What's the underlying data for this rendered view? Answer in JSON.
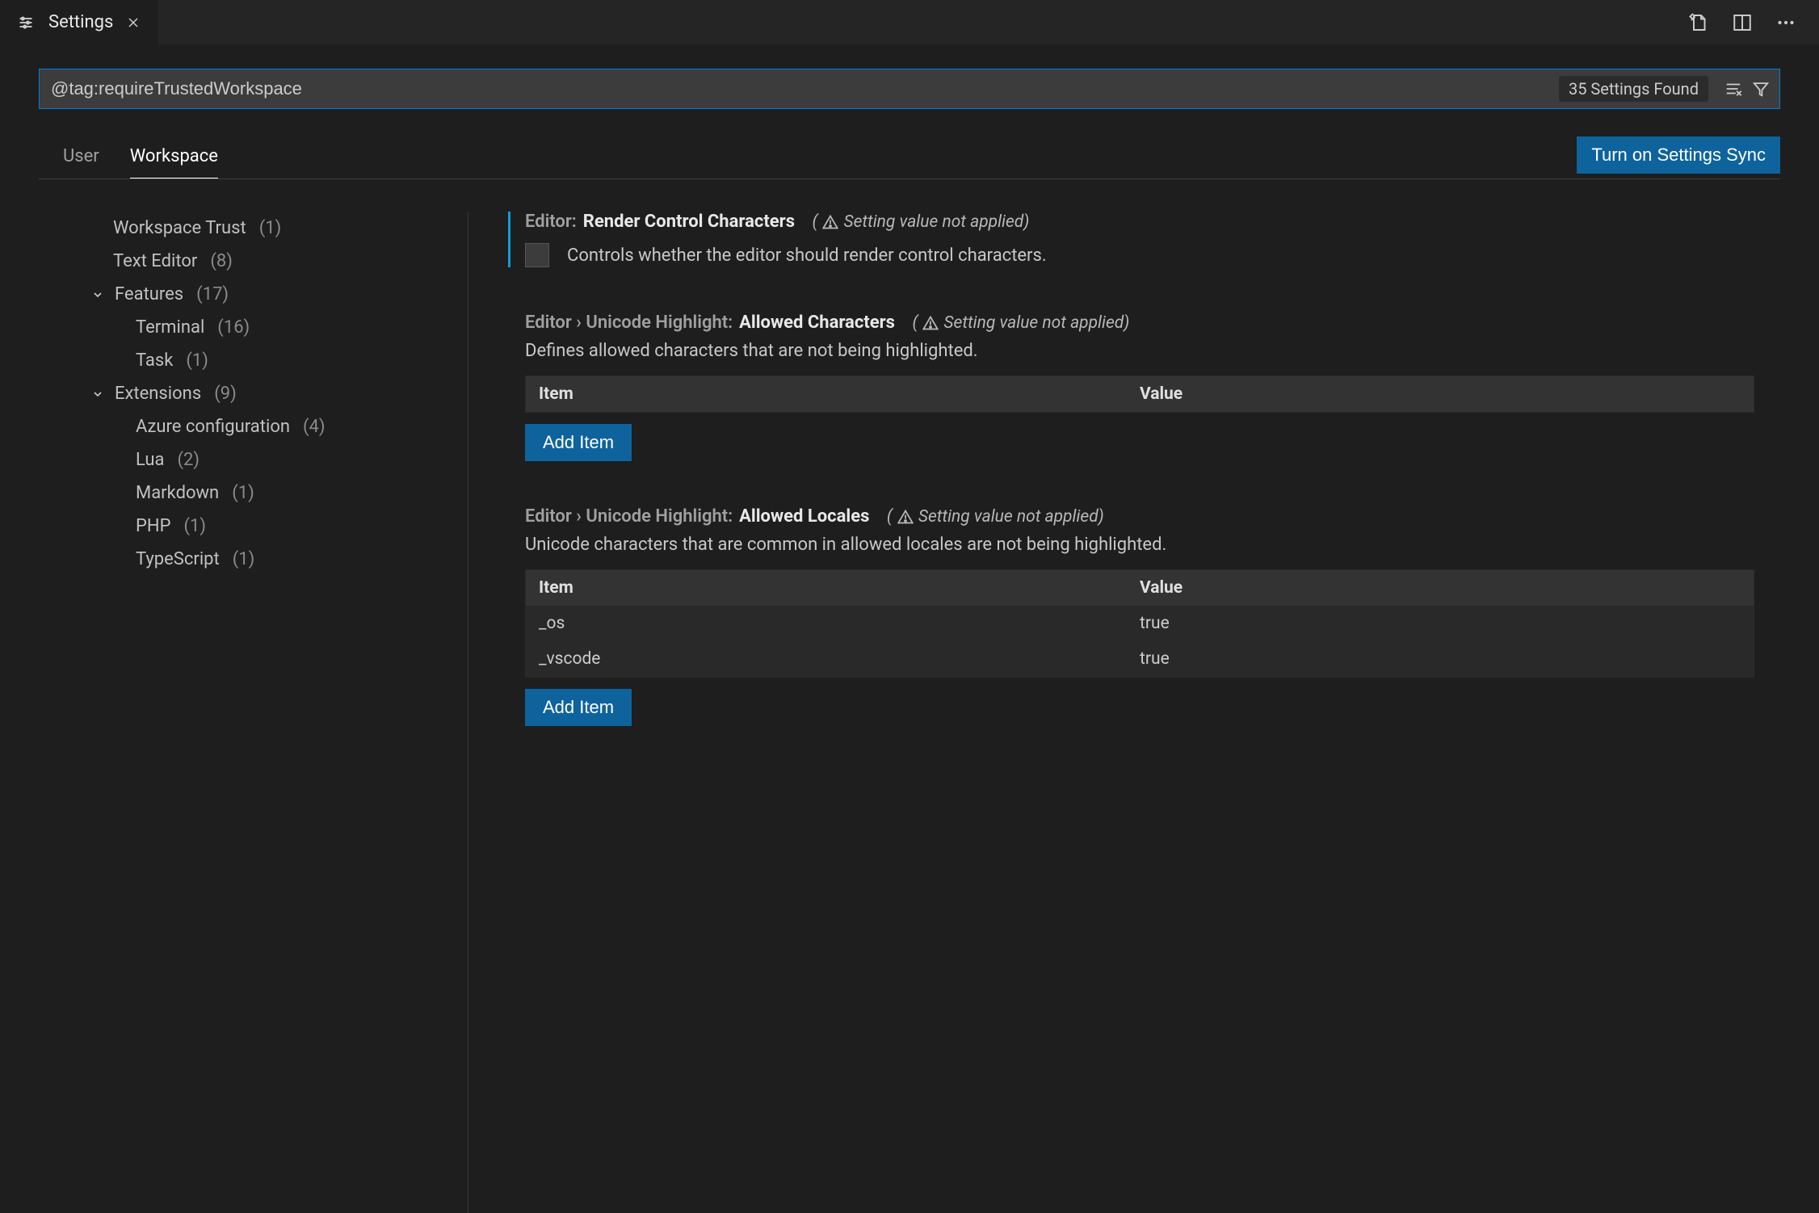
{
  "tab": {
    "title": "Settings"
  },
  "search": {
    "value": "@tag:requireTrustedWorkspace",
    "found_label": "35 Settings Found"
  },
  "scope": {
    "user": "User",
    "workspace": "Workspace",
    "sync_button": "Turn on Settings Sync"
  },
  "toc": {
    "workspace_trust": {
      "label": "Workspace Trust",
      "count": "(1)"
    },
    "text_editor": {
      "label": "Text Editor",
      "count": "(8)"
    },
    "features": {
      "label": "Features",
      "count": "(17)"
    },
    "terminal": {
      "label": "Terminal",
      "count": "(16)"
    },
    "task": {
      "label": "Task",
      "count": "(1)"
    },
    "extensions": {
      "label": "Extensions",
      "count": "(9)"
    },
    "azure": {
      "label": "Azure configuration",
      "count": "(4)"
    },
    "lua": {
      "label": "Lua",
      "count": "(2)"
    },
    "markdown": {
      "label": "Markdown",
      "count": "(1)"
    },
    "php": {
      "label": "PHP",
      "count": "(1)"
    },
    "typescript": {
      "label": "TypeScript",
      "count": "(1)"
    }
  },
  "warn_text": "Setting value not applied)",
  "warn_open": "(",
  "settings": {
    "rcc": {
      "scope": "Editor:",
      "name": "Render Control Characters",
      "desc": "Controls whether the editor should render control characters."
    },
    "allowed_chars": {
      "scope": "Editor › Unicode Highlight:",
      "name": "Allowed Characters",
      "desc": "Defines allowed characters that are not being highlighted.",
      "col_item": "Item",
      "col_value": "Value",
      "add": "Add Item"
    },
    "allowed_locales": {
      "scope": "Editor › Unicode Highlight:",
      "name": "Allowed Locales",
      "desc": "Unicode characters that are common in allowed locales are not being highlighted.",
      "col_item": "Item",
      "col_value": "Value",
      "rows": [
        {
          "item": "_os",
          "value": "true"
        },
        {
          "item": "_vscode",
          "value": "true"
        }
      ],
      "add": "Add Item"
    }
  }
}
